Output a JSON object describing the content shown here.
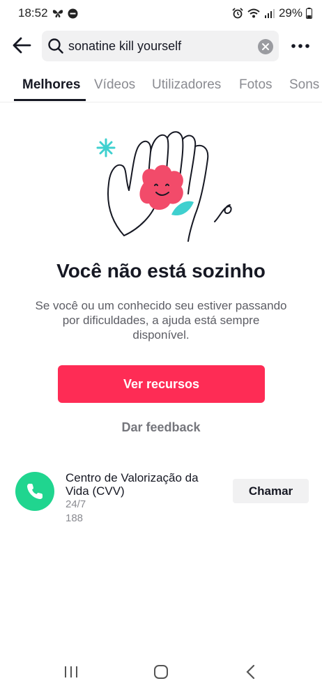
{
  "status_bar": {
    "time": "18:52",
    "battery": "29%"
  },
  "search": {
    "query": "sonatine kill yourself"
  },
  "tabs": [
    {
      "label": "Melhores",
      "active": true
    },
    {
      "label": "Vídeos",
      "active": false
    },
    {
      "label": "Utilizadores",
      "active": false
    },
    {
      "label": "Fotos",
      "active": false
    },
    {
      "label": "Sons",
      "active": false
    }
  ],
  "support": {
    "title": "Você não está sozinho",
    "message": "Se você ou um conhecido seu estiver passando por dificuldades, a ajuda está sempre disponível.",
    "resources_button": "Ver recursos",
    "feedback_link": "Dar feedback"
  },
  "resource": {
    "name": "Centro de Valorização da Vida (CVV)",
    "hours": "24/7",
    "number": "188",
    "call_label": "Chamar"
  },
  "colors": {
    "primary": "#fe2c55",
    "phone_green": "#20d58f",
    "flower": "#f24b6a",
    "accent_teal": "#3fd0cf"
  },
  "icons": {
    "back": "arrow-left-icon",
    "search": "search-icon",
    "clear": "clear-icon",
    "more": "more-icon",
    "phone": "phone-icon"
  }
}
